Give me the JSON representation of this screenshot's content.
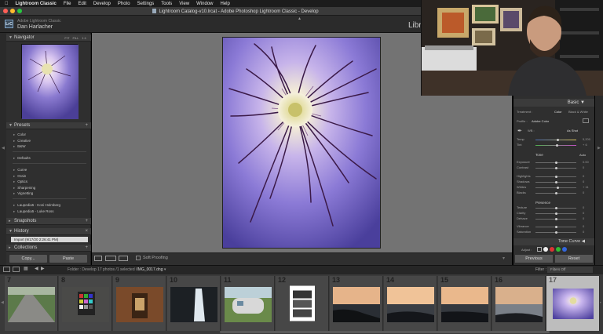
{
  "menubar": {
    "app_name": "Lightroom Classic",
    "items": [
      "File",
      "Edit",
      "Develop",
      "Photo",
      "Settings",
      "Tools",
      "View",
      "Window",
      "Help"
    ]
  },
  "window": {
    "title": "Lightroom Catalog-v10.lrcat - Adobe Photoshop Lightroom Classic - Develop"
  },
  "identity": {
    "logo": "LrC",
    "catalog_label": "Adobe Lightroom Classic",
    "user_name": "Dan Harlacher",
    "module_name": "Libra"
  },
  "left_panel": {
    "navigator": {
      "title": "Navigator",
      "options": "FIT  FILL  1:1"
    },
    "presets": {
      "title": "Presets",
      "groups_a": [
        "Color",
        "Creative",
        "B&W"
      ],
      "groups_b": [
        "Defaults"
      ],
      "groups_c": [
        "Curve",
        "Grain",
        "Optics",
        "Sharpening",
        "Vignetting"
      ],
      "groups_d": [
        "Laupedia5 - Koni Holmberg",
        "Laupedia5 - Luke Ross"
      ]
    },
    "snapshots": {
      "title": "Snapshots"
    },
    "history": {
      "title": "History",
      "item": "Import (9/17/20 2:26:41 PM)"
    },
    "collections": {
      "title": "Collections"
    },
    "copy_label": "Copy...",
    "paste_label": "Paste"
  },
  "toolbar": {
    "soft_proofing": "Soft Proofing"
  },
  "right_panel": {
    "basic_title": "Basic",
    "treatment": {
      "label": "Treatment :",
      "color": "Color",
      "bw": "Black & White"
    },
    "profile": {
      "label": "Profile :",
      "value": "Adobe Color"
    },
    "wb": {
      "label": "WB :",
      "value": "As Shot"
    },
    "tone_label": "Tone",
    "auto_label": "Auto",
    "presence_label": "Presence",
    "sliders": [
      {
        "name": "Temp",
        "value": "5,200",
        "pos": 0.55
      },
      {
        "name": "Tint",
        "value": "+ 6",
        "pos": 0.52
      },
      {
        "name": "Exposure",
        "value": "0.00",
        "pos": 0.5
      },
      {
        "name": "Contrast",
        "value": "0",
        "pos": 0.5
      },
      {
        "name": "Highlights",
        "value": "0",
        "pos": 0.5
      },
      {
        "name": "Shadows",
        "value": "0",
        "pos": 0.5
      },
      {
        "name": "Whites",
        "value": "+ 11",
        "pos": 0.55
      },
      {
        "name": "Blacks",
        "value": "0",
        "pos": 0.5
      },
      {
        "name": "Texture",
        "value": "0",
        "pos": 0.5
      },
      {
        "name": "Clarity",
        "value": "0",
        "pos": 0.5
      },
      {
        "name": "Dehaze",
        "value": "0",
        "pos": 0.5
      },
      {
        "name": "Vibrance",
        "value": "0",
        "pos": 0.5
      },
      {
        "name": "Saturation",
        "value": "0",
        "pos": 0.5
      }
    ],
    "tone_curve_title": "Tone Curve",
    "adjust_label": "Adjust :",
    "previous_label": "Previous",
    "reset_label": "Reset"
  },
  "filmstrip": {
    "folder": "Folder : Develop",
    "count": "17 photos /1 selected /",
    "file": "IMG_0017.dng",
    "filter_label": "Filter :",
    "filter_value": "Filters Off",
    "numbers": [
      "7",
      "8",
      "9",
      "10",
      "11",
      "12",
      "13",
      "14",
      "15",
      "16",
      "17"
    ]
  },
  "colors": {
    "panel": "#2f2f2f",
    "canvas": "#737373",
    "flower_purple": "#7e6ec4",
    "accent": "#7fa2c4"
  }
}
